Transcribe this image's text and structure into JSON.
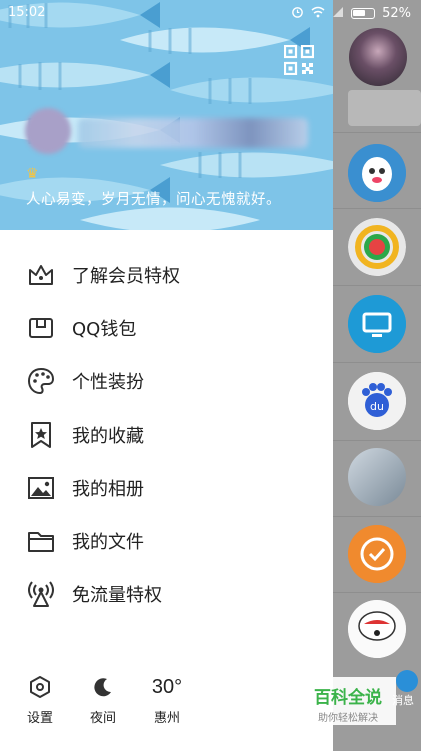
{
  "status_bar": {
    "time": "15:02",
    "battery": "52%"
  },
  "profile": {
    "signature": "人心易变，岁月无情，问心无愧就好。"
  },
  "menu": {
    "items": [
      {
        "label": "了解会员特权",
        "icon": "crown-icon"
      },
      {
        "label": "QQ钱包",
        "icon": "wallet-icon"
      },
      {
        "label": "个性装扮",
        "icon": "palette-icon"
      },
      {
        "label": "我的收藏",
        "icon": "bookmark-icon"
      },
      {
        "label": "我的相册",
        "icon": "photo-icon"
      },
      {
        "label": "我的文件",
        "icon": "folder-icon"
      },
      {
        "label": "免流量特权",
        "icon": "signal-tower-icon"
      }
    ]
  },
  "footer": {
    "settings": "设置",
    "night": "夜间",
    "temperature": "30°",
    "city": "惠州"
  },
  "background": {
    "messages_tab": "消息"
  },
  "watermark": {
    "title": "百科全说",
    "subtitle": "助你轻松解决"
  },
  "colors": {
    "header_bg": "#7ec4e8",
    "accent_blue": "#2a8fd8",
    "watermark_green": "#3bb34a"
  }
}
